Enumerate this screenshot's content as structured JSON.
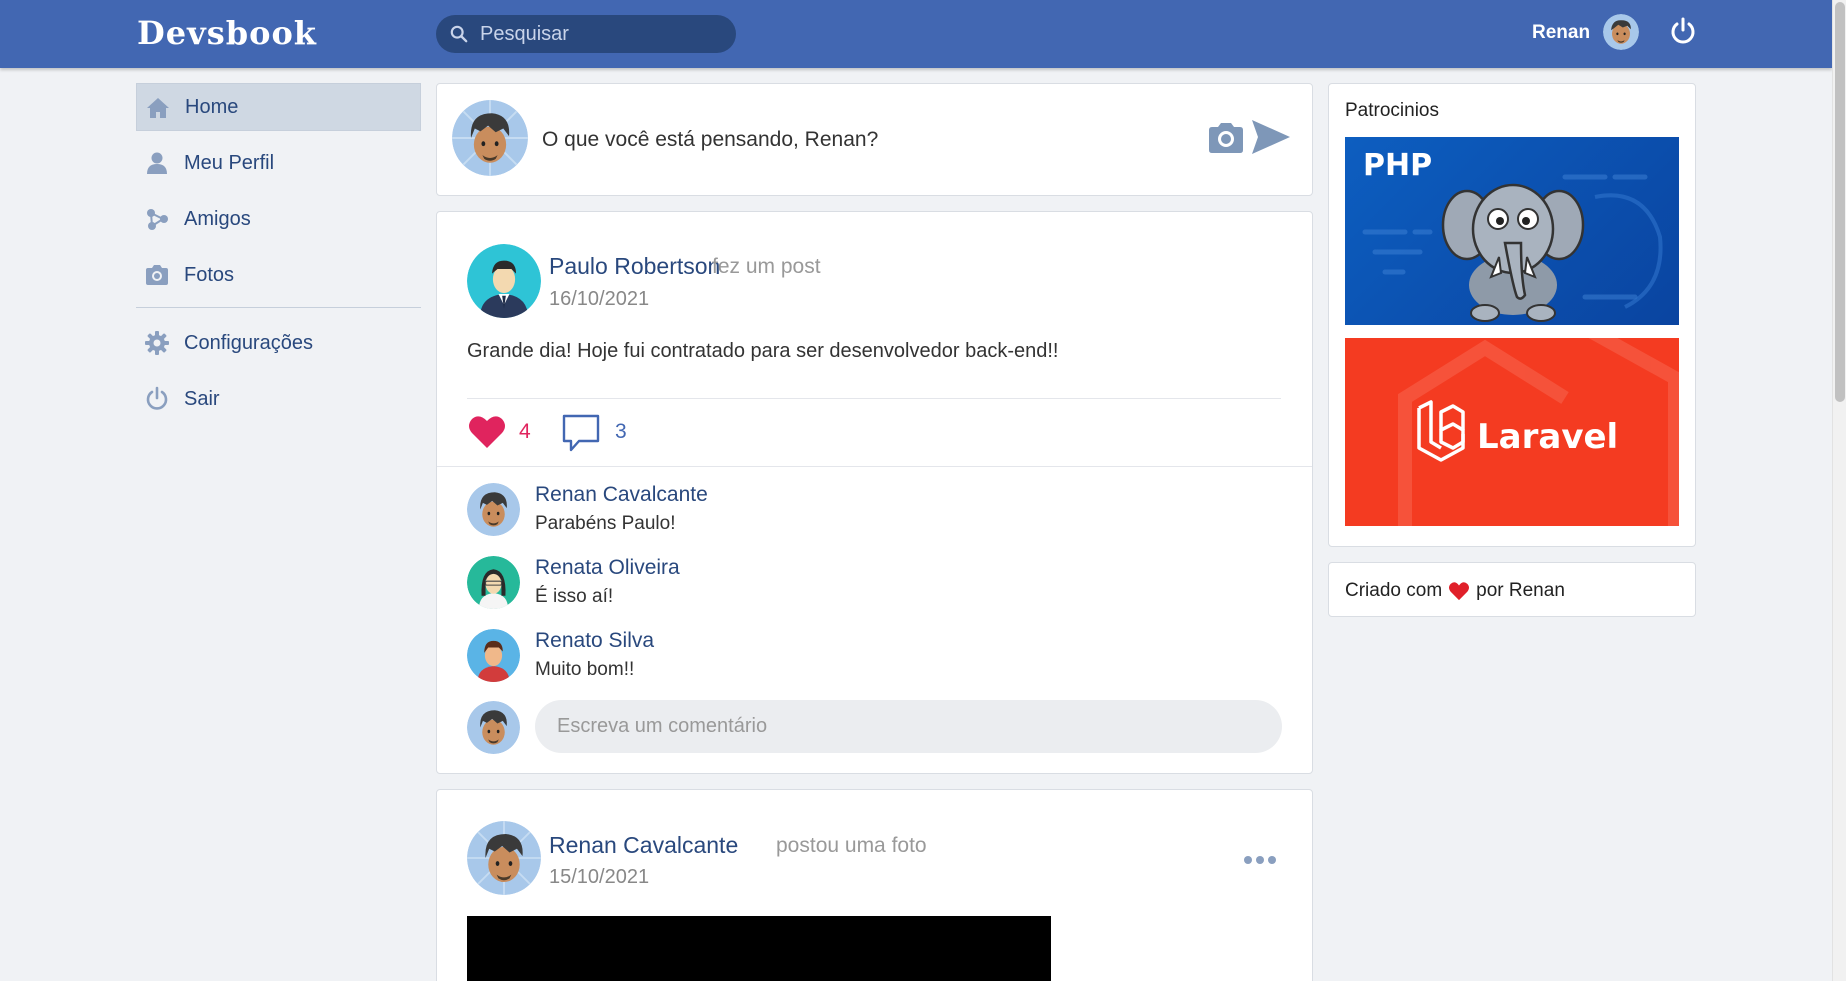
{
  "header": {
    "logo": "Devsbook",
    "search_placeholder": "Pesquisar",
    "user_name": "Renan",
    "icons": [
      "search-icon",
      "avatar",
      "power-icon"
    ]
  },
  "menu": {
    "items": [
      {
        "label": "Home",
        "icon": "home-icon",
        "active": true
      },
      {
        "label": "Meu Perfil",
        "icon": "user-icon"
      },
      {
        "label": "Amigos",
        "icon": "friends-icon"
      },
      {
        "label": "Fotos",
        "icon": "camera-icon"
      }
    ],
    "secondary": [
      {
        "label": "Configurações",
        "icon": "gear-icon"
      },
      {
        "label": "Sair",
        "icon": "power-icon"
      }
    ]
  },
  "composer": {
    "prompt": "O que você está pensando, Renan?"
  },
  "posts": [
    {
      "author": "Paulo Robertson",
      "action": "fez um post",
      "date": "16/10/2021",
      "body": "Grande dia! Hoje fui contratado para ser desenvolvedor back-end!!",
      "likes": "4",
      "comments_count": "3",
      "comments": [
        {
          "name": "Renan Cavalcante",
          "text": "Parabéns Paulo!"
        },
        {
          "name": "Renata Oliveira",
          "text": "É isso aí!"
        },
        {
          "name": "Renato Silva",
          "text": "Muito bom!!"
        }
      ],
      "comment_placeholder": "Escreva um comentário"
    },
    {
      "author": "Renan Cavalcante",
      "action": "postou uma foto",
      "date": "15/10/2021"
    }
  ],
  "sidebar": {
    "sponsors_title": "Patrocinios",
    "ads": [
      {
        "label": "PHP",
        "color": "#0d5ec0"
      },
      {
        "label": "Laravel",
        "color": "#f43b21"
      }
    ],
    "credit_before": "Criado com",
    "credit_after": "por Renan"
  },
  "colors": {
    "brand": "#4267b2",
    "link": "#29487d",
    "like": "#e0245e"
  }
}
